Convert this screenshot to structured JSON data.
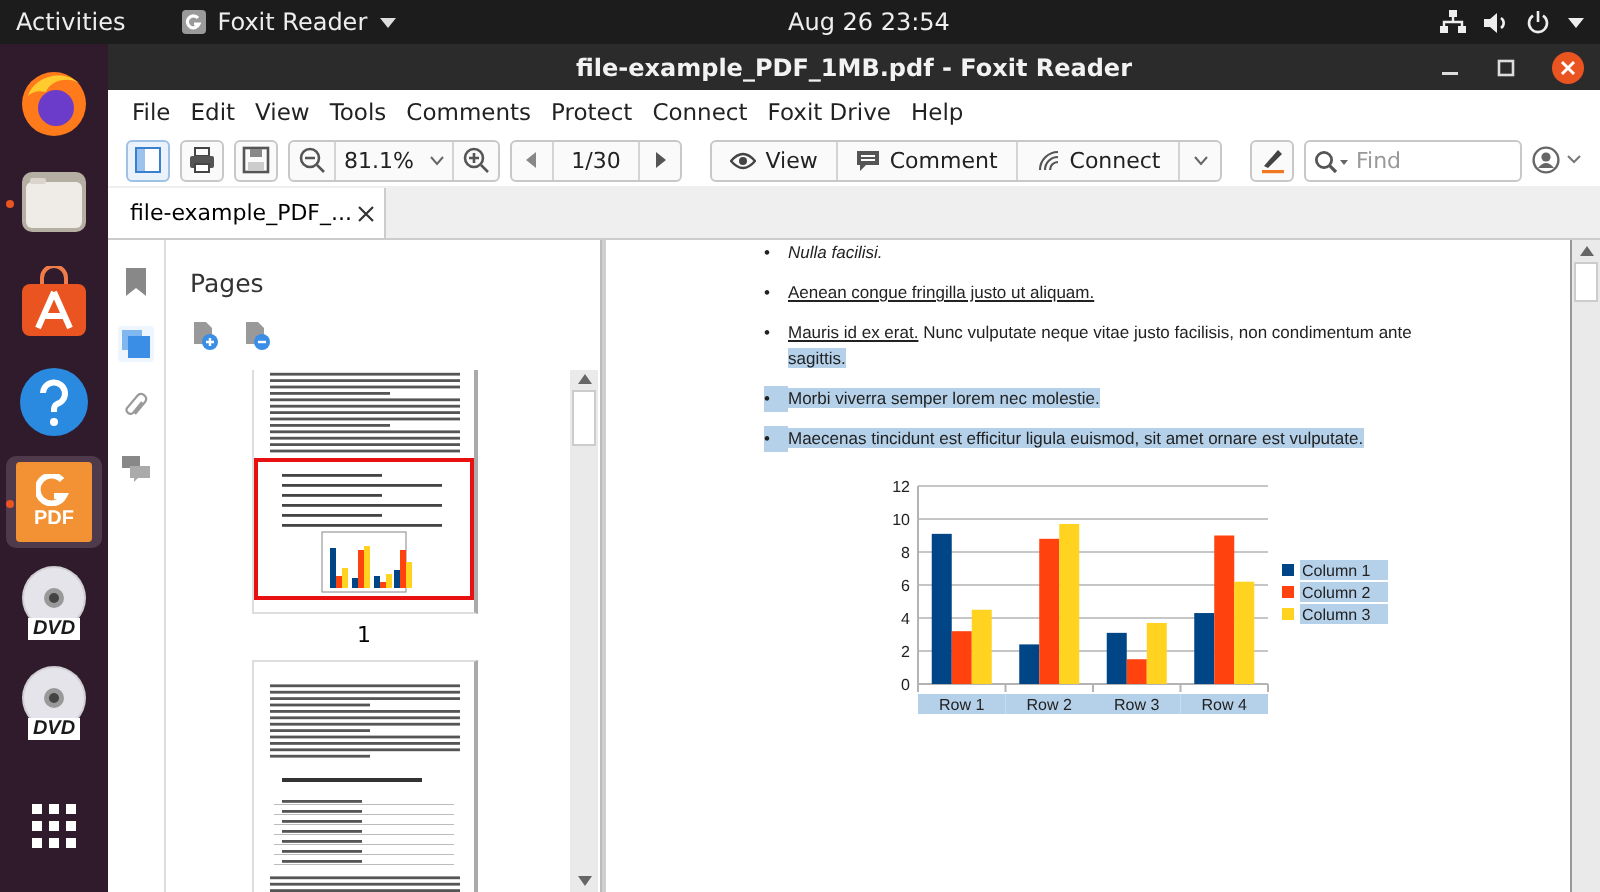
{
  "top_bar": {
    "activities": "Activities",
    "app_menu": "Foxit Reader",
    "clock": "Aug 26  23:54"
  },
  "dock": [
    {
      "kind": "firefox",
      "running": false,
      "selected": false
    },
    {
      "kind": "files",
      "running": true,
      "selected": false
    },
    {
      "kind": "software",
      "running": false,
      "selected": false
    },
    {
      "kind": "help",
      "running": false,
      "selected": false
    },
    {
      "kind": "foxit",
      "badge": "PDF",
      "running": true,
      "selected": true
    },
    {
      "kind": "dvd",
      "badge": "DVD",
      "running": false,
      "selected": false
    },
    {
      "kind": "dvd",
      "badge": "DVD",
      "running": false,
      "selected": false
    },
    {
      "kind": "apps",
      "running": false,
      "selected": false
    }
  ],
  "window": {
    "title": "file-example_PDF_1MB.pdf - Foxit Reader"
  },
  "menu": [
    "File",
    "Edit",
    "View",
    "Tools",
    "Comments",
    "Protect",
    "Connect",
    "Foxit Drive",
    "Help"
  ],
  "toolbar": {
    "zoom": "81.1%",
    "page": "1/30",
    "view_button": "View",
    "comment_button": "Comment",
    "connect_button": "Connect",
    "find_placeholder": "Find"
  },
  "tabs": [
    {
      "label": "file-example_PDF_...",
      "selected": true
    }
  ],
  "side_icons": [
    {
      "kind": "bookmark",
      "selected": false
    },
    {
      "kind": "pages",
      "selected": true
    },
    {
      "kind": "attachment",
      "selected": false
    },
    {
      "kind": "comments",
      "selected": false
    }
  ],
  "pages_panel": {
    "title": "Pages",
    "thumbnails": [
      {
        "label": "1",
        "selected": true
      },
      {
        "selected": false
      }
    ]
  },
  "document": {
    "list": [
      {
        "bullet": "•",
        "highlighted": false,
        "segments": [
          {
            "text": "Nulla facilisi.",
            "italic": true,
            "underline": false,
            "highlight": false
          }
        ]
      },
      {
        "bullet": "•",
        "highlighted": false,
        "segments": [
          {
            "text": "Aenean congue fringilla justo ut aliquam.",
            "italic": false,
            "underline": true,
            "highlight": false
          }
        ]
      },
      {
        "bullet": "•",
        "highlighted": false,
        "segments": [
          {
            "text": "Mauris id ex erat.",
            "italic": false,
            "underline": true,
            "highlight": false
          },
          {
            "text": "Nunc vulputate neque vitae justo facilisis, non condimentum ante",
            "italic": false,
            "underline": false,
            "highlight": false
          },
          {
            "text": "sagittis.",
            "italic": false,
            "underline": false,
            "highlight": true
          }
        ]
      },
      {
        "bullet": "•",
        "highlighted": true,
        "segments": [
          {
            "text": "Morbi viverra semper lorem nec molestie.",
            "italic": false,
            "underline": false,
            "highlight": true
          }
        ]
      },
      {
        "bullet": "•",
        "highlighted": true,
        "segments": [
          {
            "text": "Maecenas tincidunt est efficitur ligula euismod, sit amet ornare est vulputate.",
            "italic": false,
            "underline": false,
            "highlight": true
          }
        ]
      }
    ],
    "chart_highlighted": true,
    "chart_data": {
      "type": "bar",
      "categories": [
        "Row 1",
        "Row 2",
        "Row 3",
        "Row 4"
      ],
      "ylim": [
        0,
        12
      ],
      "yticks": [
        0,
        2,
        4,
        6,
        8,
        10,
        12
      ],
      "grid": "y",
      "legend": true,
      "series": [
        {
          "name": "Column 1",
          "color": "#004586",
          "values": [
            9.1,
            2.4,
            3.1,
            4.3
          ]
        },
        {
          "name": "Column 2",
          "color": "#ff420e",
          "values": [
            3.2,
            8.8,
            1.5,
            9.0
          ]
        },
        {
          "name": "Column 3",
          "color": "#ffd320",
          "values": [
            4.5,
            9.7,
            3.7,
            6.2
          ]
        }
      ]
    }
  }
}
